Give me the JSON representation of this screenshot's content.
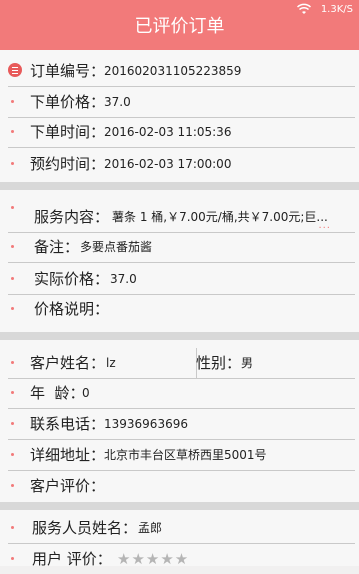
{
  "statusbar": {
    "net_speed": "1.3K/S"
  },
  "header": {
    "title": "已评价订单"
  },
  "order": {
    "number_label": "订单编号：",
    "number_value": "201602031105223859",
    "price_label": "下单价格：",
    "price_value": "37.0",
    "time_label": "下单时间：",
    "time_value": "2016-02-03 11:05:36",
    "appt_label": "预约时间：",
    "appt_value": "2016-02-03 17:00:00"
  },
  "service": {
    "content_label": "服务内容：",
    "content_value": "薯条 1 桶,￥7.00元/桶,共￥7.00元;巨...",
    "more": "···",
    "remark_label": "备注：",
    "remark_value": "多要点番茄酱",
    "actual_label": "实际价格：",
    "actual_value": "37.0",
    "price_note_label": "价格说明："
  },
  "customer": {
    "name_label": "客户姓名：",
    "name_value": "lz",
    "gender_label": "性别：",
    "gender_value": "男",
    "age_label": "年  龄：",
    "age_value": "0",
    "phone_label": "联系电话：",
    "phone_value": "13936963696",
    "address_label": "详细地址：",
    "address_value": "北京市丰台区草桥西里5001号",
    "review_label": "客户评价："
  },
  "staff": {
    "name_label": "服务人员姓名：",
    "name_value": "孟郎",
    "rating_label": "用户 评价：",
    "rating_stars": "★★★★★",
    "rating_value": 0
  }
}
